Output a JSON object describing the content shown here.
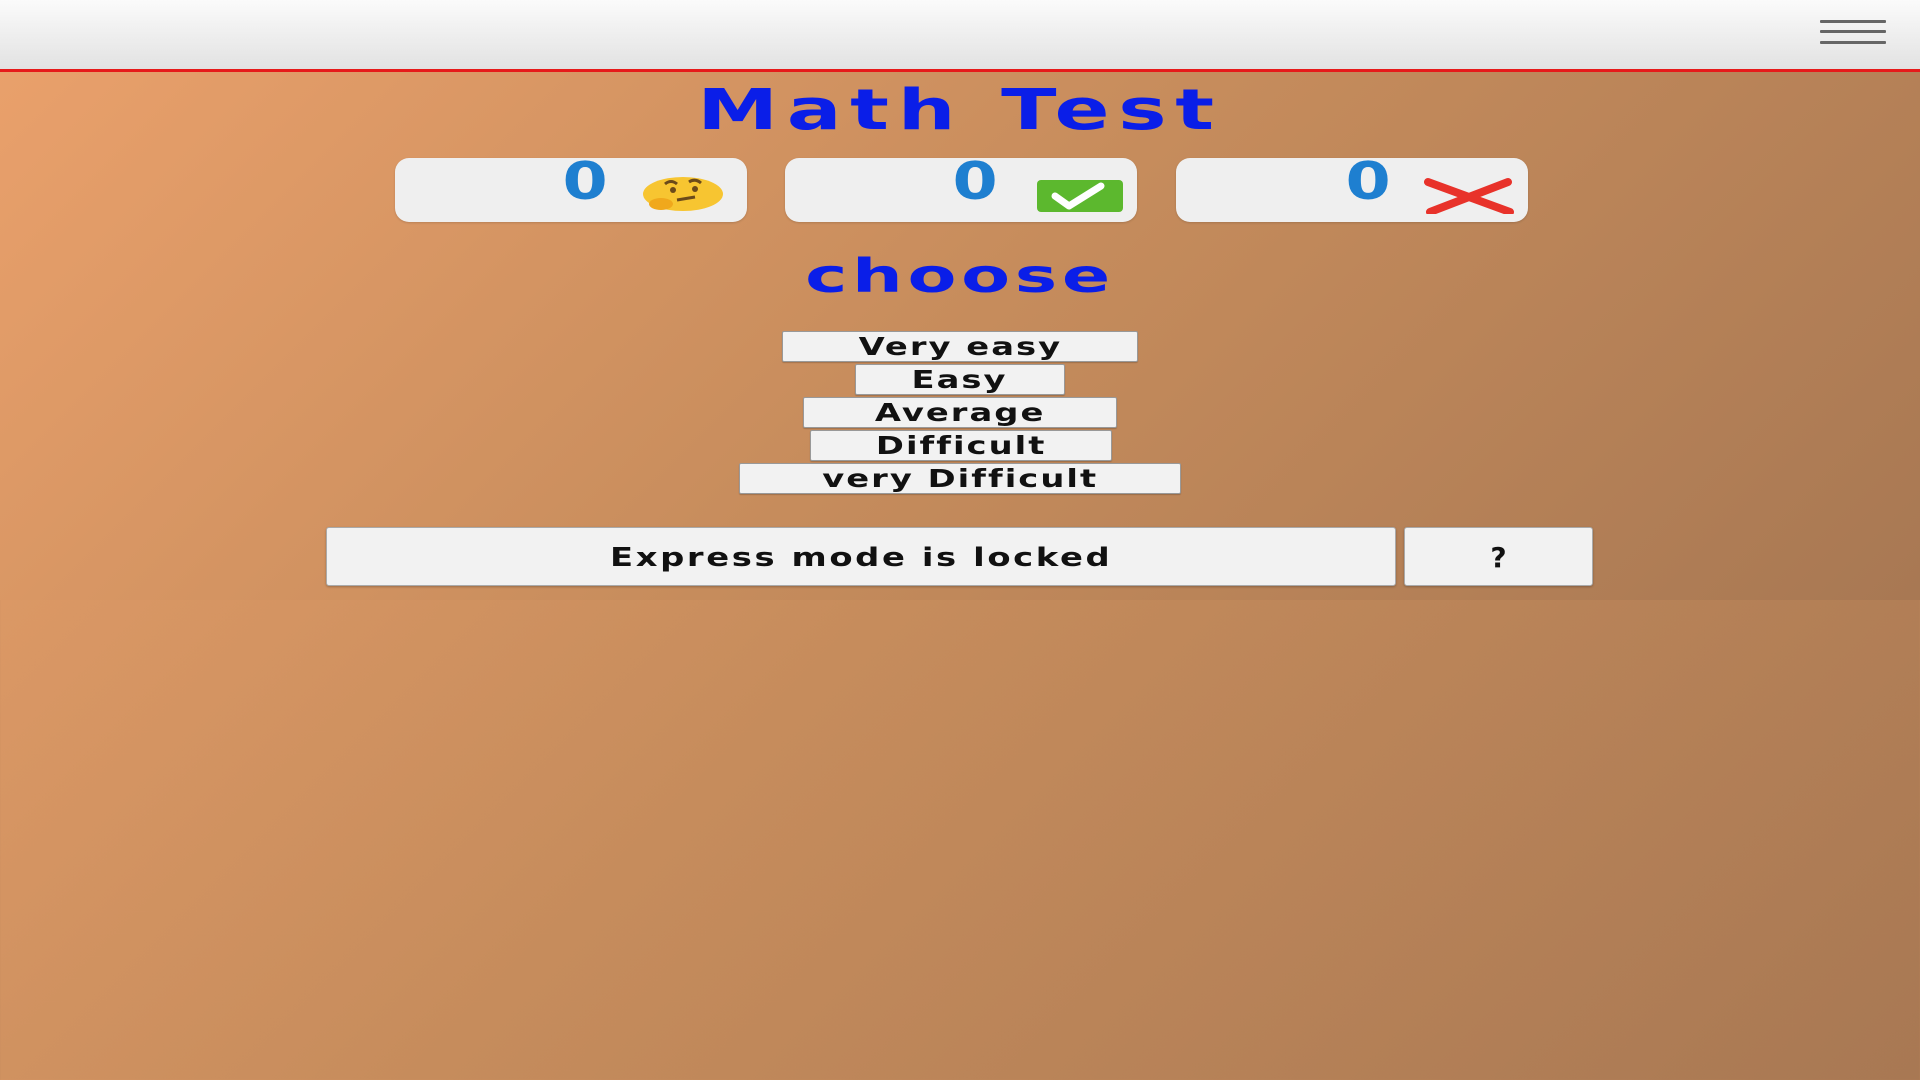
{
  "header": {
    "menu_icon": "hamburger-menu-icon"
  },
  "title": "Math Test",
  "scores": [
    {
      "value": "0",
      "icon": "thinking-face-icon"
    },
    {
      "value": "0",
      "icon": "check-mark-icon"
    },
    {
      "value": "0",
      "icon": "cross-mark-icon"
    }
  ],
  "prompt": "choose",
  "levels": [
    {
      "label": "Very easy"
    },
    {
      "label": "Easy"
    },
    {
      "label": "Average"
    },
    {
      "label": "Difficult"
    },
    {
      "label": "very Difficult"
    }
  ],
  "express": {
    "label": "Express mode is locked",
    "help_label": "?"
  },
  "colors": {
    "title": "#0a1ee8",
    "score": "#1e7fd0",
    "header_border": "#e61a1a"
  }
}
